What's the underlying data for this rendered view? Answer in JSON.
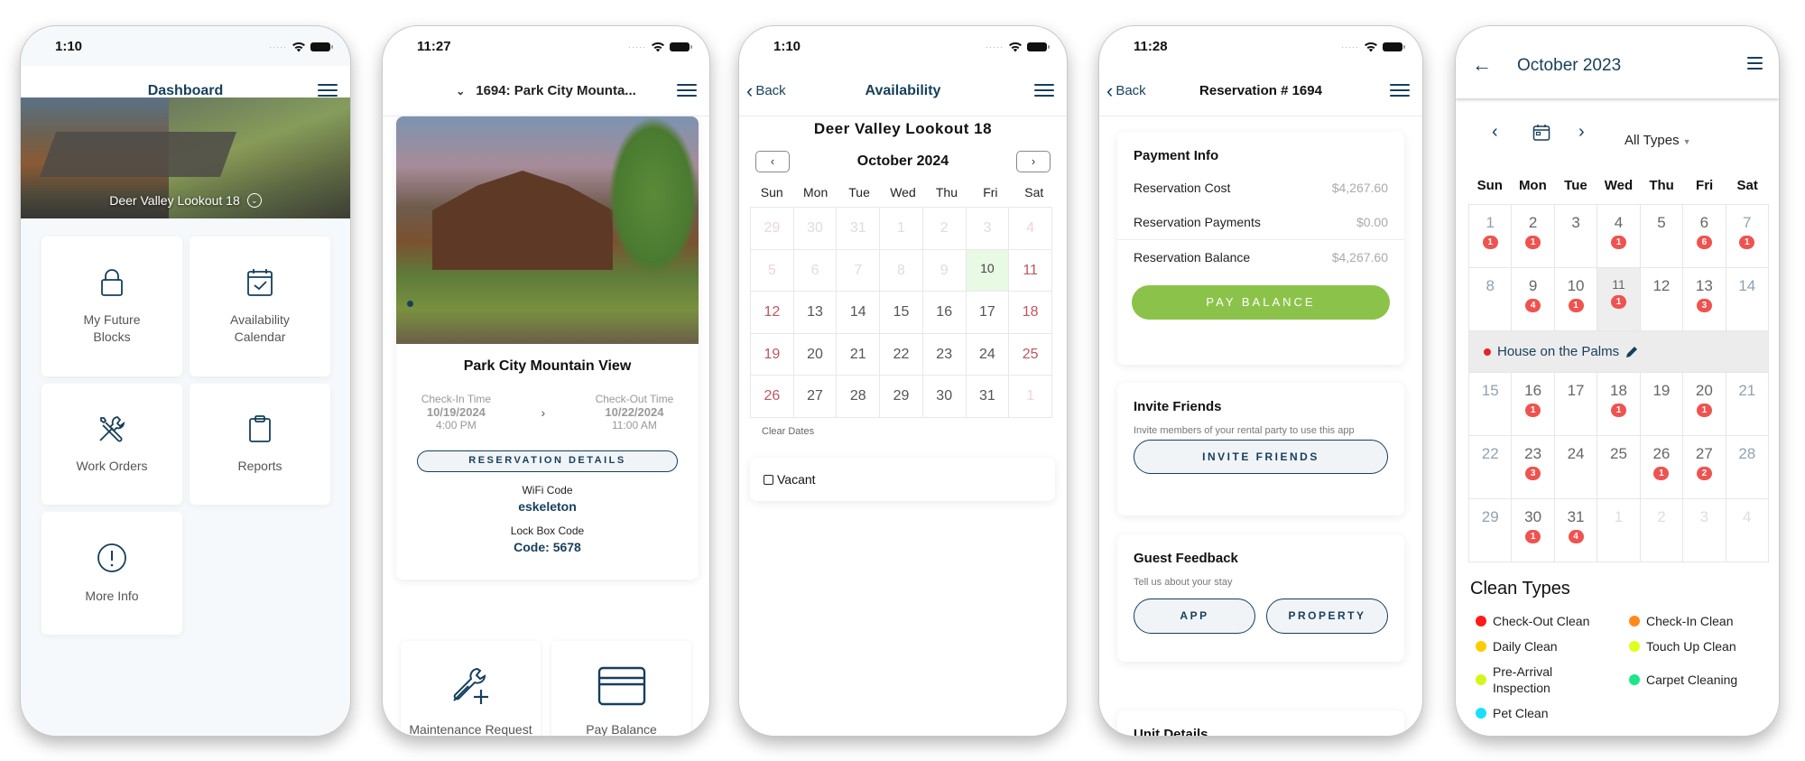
{
  "screens": {
    "dashboard": {
      "status_time": "1:10",
      "title": "Dashboard",
      "property_name": "Deer Valley Lookout 18",
      "tiles": [
        {
          "label": "My Future\nBlocks",
          "icon": "lock-icon"
        },
        {
          "label": "Availability\nCalendar",
          "icon": "calendar-check-icon"
        },
        {
          "label": "Work Orders",
          "icon": "tools-icon"
        },
        {
          "label": "Reports",
          "icon": "clipboard-icon"
        },
        {
          "label": "More Info",
          "icon": "info-circle-icon"
        }
      ]
    },
    "reservation_overview": {
      "status_time": "11:27",
      "title": "1694: Park City Mounta...",
      "property_name": "Park City Mountain View",
      "check_in": {
        "label": "Check-In Time",
        "date": "10/19/2024",
        "time": "4:00 PM"
      },
      "check_out": {
        "label": "Check-Out Time",
        "date": "10/22/2024",
        "time": "11:00 AM"
      },
      "reservation_details_button": "RESERVATION DETAILS",
      "wifi_label": "WiFi Code",
      "wifi_value": "eskeleton",
      "lockbox_label": "Lock Box Code",
      "lockbox_value": "Code: 5678",
      "tiles": [
        {
          "label": "Maintenance Request",
          "icon": "wrench-plus-icon"
        },
        {
          "label": "Pay Balance",
          "icon": "credit-card-icon"
        }
      ]
    },
    "availability": {
      "status_time": "1:10",
      "back_label": "Back",
      "title": "Availability",
      "property_name": "Deer Valley Lookout 18",
      "month": "October 2024",
      "prev_label": "‹",
      "next_label": "›",
      "weekdays": [
        "Sun",
        "Mon",
        "Tue",
        "Wed",
        "Thu",
        "Fri",
        "Sat"
      ],
      "days": [
        {
          "d": "29",
          "s": "ow"
        },
        {
          "d": "30",
          "s": "o"
        },
        {
          "d": "31",
          "s": "o"
        },
        {
          "d": "1",
          "s": "o"
        },
        {
          "d": "2",
          "s": "o"
        },
        {
          "d": "3",
          "s": "o"
        },
        {
          "d": "4",
          "s": "ow"
        },
        {
          "d": "5",
          "s": "ow"
        },
        {
          "d": "6",
          "s": "o"
        },
        {
          "d": "7",
          "s": "o"
        },
        {
          "d": "8",
          "s": "o"
        },
        {
          "d": "9",
          "s": "o"
        },
        {
          "d": "10",
          "s": "tod"
        },
        {
          "d": "11",
          "s": "we"
        },
        {
          "d": "12",
          "s": "we"
        },
        {
          "d": "13",
          "s": ""
        },
        {
          "d": "14",
          "s": ""
        },
        {
          "d": "15",
          "s": ""
        },
        {
          "d": "16",
          "s": ""
        },
        {
          "d": "17",
          "s": ""
        },
        {
          "d": "18",
          "s": "we"
        },
        {
          "d": "19",
          "s": "we"
        },
        {
          "d": "20",
          "s": ""
        },
        {
          "d": "21",
          "s": ""
        },
        {
          "d": "22",
          "s": ""
        },
        {
          "d": "23",
          "s": ""
        },
        {
          "d": "24",
          "s": ""
        },
        {
          "d": "25",
          "s": "we"
        },
        {
          "d": "26",
          "s": "we"
        },
        {
          "d": "27",
          "s": ""
        },
        {
          "d": "28",
          "s": ""
        },
        {
          "d": "29",
          "s": ""
        },
        {
          "d": "30",
          "s": ""
        },
        {
          "d": "31",
          "s": ""
        },
        {
          "d": "1",
          "s": "ow"
        }
      ],
      "clear_dates": "Clear Dates",
      "vacant_label": "Vacant",
      "vacant_checked": false
    },
    "reservation": {
      "status_time": "11:28",
      "back_label": "Back",
      "title": "Reservation # 1694",
      "payment_info": {
        "heading": "Payment Info",
        "rows": [
          {
            "label": "Reservation Cost",
            "value": "$4,267.60"
          },
          {
            "label": "Reservation Payments",
            "value": "$0.00"
          },
          {
            "label": "Reservation Balance",
            "value": "$4,267.60"
          }
        ],
        "pay_button": "PAY BALANCE"
      },
      "invite_friends": {
        "heading": "Invite Friends",
        "description": "Invite members of your rental party to use this app",
        "button": "INVITE FRIENDS"
      },
      "guest_feedback": {
        "heading": "Guest Feedback",
        "description": "Tell us about your stay",
        "buttons": [
          "APP",
          "PROPERTY"
        ]
      },
      "unit_details": {
        "heading": "Unit Details"
      }
    },
    "clean_calendar": {
      "title": "October 2023",
      "filter": "All Types",
      "weekdays": [
        "Sun",
        "Mon",
        "Tue",
        "Wed",
        "Thu",
        "Fri",
        "Sat"
      ],
      "weeks": [
        [
          {
            "d": "1",
            "b": "1",
            "s": "we"
          },
          {
            "d": "2",
            "b": "1"
          },
          {
            "d": "3"
          },
          {
            "d": "4",
            "b": "1"
          },
          {
            "d": "5"
          },
          {
            "d": "6",
            "b": "6"
          },
          {
            "d": "7",
            "b": "1",
            "s": "we"
          }
        ],
        [
          {
            "d": "8",
            "s": "we"
          },
          {
            "d": "9",
            "b": "4"
          },
          {
            "d": "10",
            "b": "1"
          },
          {
            "d": "11",
            "b": "1",
            "s": "sel"
          },
          {
            "d": "12"
          },
          {
            "d": "13",
            "b": "3"
          },
          {
            "d": "14",
            "s": "we"
          }
        ],
        [
          {
            "d": "15",
            "s": "we"
          },
          {
            "d": "16",
            "b": "1"
          },
          {
            "d": "17"
          },
          {
            "d": "18",
            "b": "1"
          },
          {
            "d": "19"
          },
          {
            "d": "20",
            "b": "1"
          },
          {
            "d": "21",
            "s": "we"
          }
        ],
        [
          {
            "d": "22",
            "s": "we"
          },
          {
            "d": "23",
            "b": "3"
          },
          {
            "d": "24"
          },
          {
            "d": "25"
          },
          {
            "d": "26",
            "b": "1"
          },
          {
            "d": "27",
            "b": "2"
          },
          {
            "d": "28",
            "s": "we"
          }
        ],
        [
          {
            "d": "29",
            "s": "we"
          },
          {
            "d": "30",
            "b": "1"
          },
          {
            "d": "31",
            "b": "4"
          },
          {
            "d": "1",
            "s": "o"
          },
          {
            "d": "2",
            "s": "o"
          },
          {
            "d": "3",
            "s": "o"
          },
          {
            "d": "4",
            "s": "o"
          }
        ]
      ],
      "selected_event": {
        "name": "House on the Palms",
        "color": "#e5222a"
      },
      "legend_title": "Clean Types",
      "legend": [
        {
          "label": "Check-Out Clean",
          "color": "#ff1a1a"
        },
        {
          "label": "Check-In Clean",
          "color": "#ff8a1a"
        },
        {
          "label": "Daily Clean",
          "color": "#ffcc00"
        },
        {
          "label": "Touch Up Clean",
          "color": "#e0ff1a"
        },
        {
          "label": "Pre-Arrival\nInspection",
          "color": "#d8f51a"
        },
        {
          "label": "Carpet Cleaning",
          "color": "#1ae68a"
        },
        {
          "label": "Pet Clean",
          "color": "#1ae0ff"
        }
      ]
    }
  }
}
